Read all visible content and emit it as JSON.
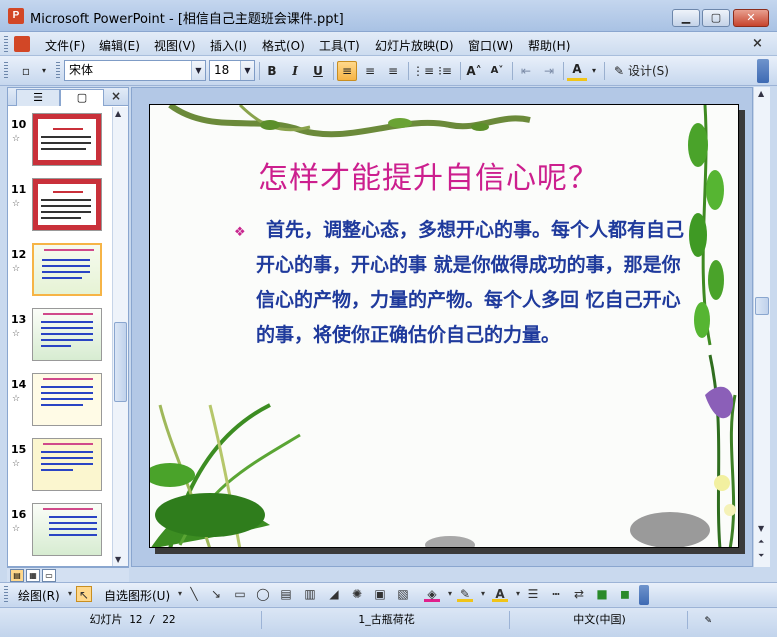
{
  "window": {
    "title": "Microsoft PowerPoint - [相信自己主题班会课件.ppt]",
    "app_icon": "powerpoint-icon",
    "min_label": "▁",
    "max_label": "▢",
    "close_label": "✕"
  },
  "menu": {
    "items": [
      "文件(F)",
      "编辑(E)",
      "视图(V)",
      "插入(I)",
      "格式(O)",
      "工具(T)",
      "幻灯片放映(D)",
      "窗口(W)",
      "帮助(H)"
    ],
    "close_label": "×"
  },
  "toolbar": {
    "font_name": "宋体",
    "font_size": "18",
    "bold": "B",
    "italic": "I",
    "underline": "U",
    "design_label": "设计(S)"
  },
  "panel": {
    "close_label": "×",
    "slides": [
      {
        "num": "10",
        "style": "red"
      },
      {
        "num": "11",
        "style": "red"
      },
      {
        "num": "12",
        "style": "green"
      },
      {
        "num": "13",
        "style": "flower"
      },
      {
        "num": "14",
        "style": "cream"
      },
      {
        "num": "15",
        "style": "yellow"
      },
      {
        "num": "16",
        "style": "flower"
      }
    ]
  },
  "slide": {
    "title": "怎样才能提升自信心呢？",
    "bullet": "❖",
    "body": "首先，调整心态，多想开心的事。每个人都有自己开心的事，开心的事 就是你做得成功的事，那是你信心的产物，力量的产物。每个人多回 忆自己开心的事，将使你正确估价自己的力量。"
  },
  "drawbar": {
    "draw_label": "绘图(R)",
    "autoshape_label": "自选图形(U)"
  },
  "status": {
    "slide_info": "幻灯片 12 / 22",
    "design": "1_古瓶荷花",
    "language": "中文(中国)"
  },
  "colors": {
    "title": "#cc1f8e",
    "body": "#1f3a9c",
    "accent": "#d24726"
  }
}
